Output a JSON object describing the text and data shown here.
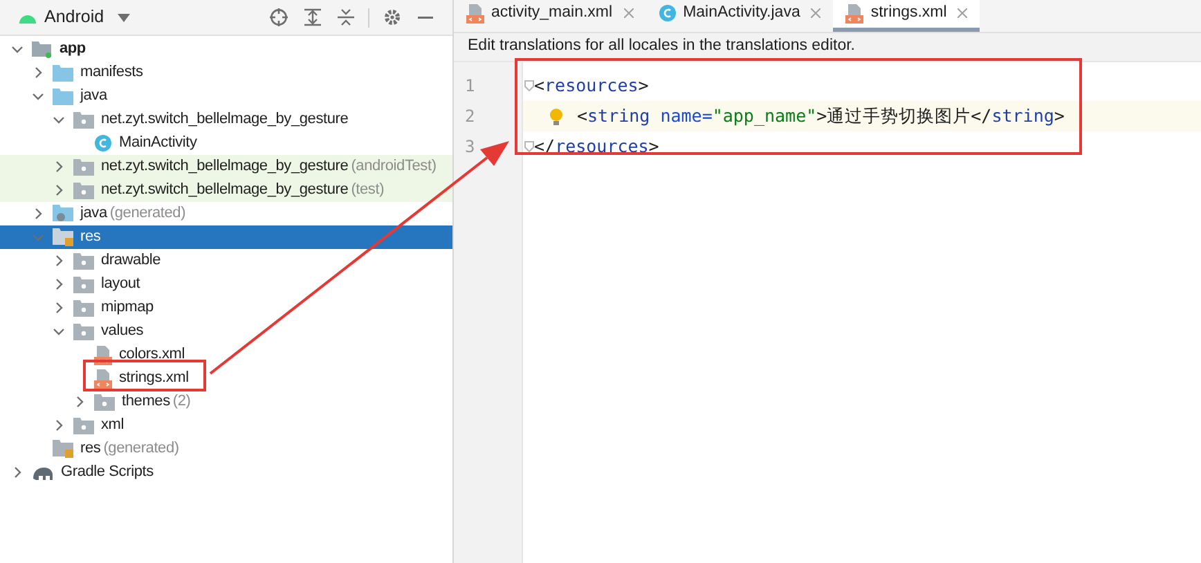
{
  "project_panel": {
    "view_selector": "Android",
    "tree": [
      {
        "label": "app",
        "bold": true,
        "kind": "module",
        "expanded": true,
        "selected": false,
        "highlighted": false,
        "children": [
          {
            "label": "manifests",
            "kind": "folder",
            "expanded": false,
            "selected": false,
            "highlighted": false
          },
          {
            "label": "java",
            "kind": "folder",
            "expanded": true,
            "selected": false,
            "highlighted": false,
            "children": [
              {
                "label": "net.zyt.switch_bellelmage_by_gesture",
                "kind": "package",
                "expanded": true,
                "selected": false,
                "highlighted": false,
                "children": [
                  {
                    "label": "MainActivity",
                    "kind": "class",
                    "selected": false,
                    "highlighted": false
                  }
                ]
              },
              {
                "label": "net.zyt.switch_bellelmage_by_gesture",
                "suffix": "(androidTest)",
                "kind": "package",
                "expanded": false,
                "selected": false,
                "highlighted": true
              },
              {
                "label": "net.zyt.switch_bellelmage_by_gesture",
                "suffix": "(test)",
                "kind": "package",
                "expanded": false,
                "selected": false,
                "highlighted": true
              }
            ]
          },
          {
            "label": "java",
            "suffix": "(generated)",
            "kind": "generated",
            "expanded": false,
            "selected": false,
            "highlighted": false
          },
          {
            "label": "res",
            "kind": "resfolder",
            "expanded": true,
            "selected": true,
            "children": [
              {
                "label": "drawable",
                "kind": "package",
                "expanded": false,
                "selected": false,
                "highlighted": false
              },
              {
                "label": "layout",
                "kind": "package",
                "expanded": false,
                "selected": false,
                "highlighted": false
              },
              {
                "label": "mipmap",
                "kind": "package",
                "expanded": false,
                "selected": false,
                "highlighted": false
              },
              {
                "label": "values",
                "kind": "package",
                "expanded": true,
                "selected": false,
                "highlighted": false,
                "children": [
                  {
                    "label": "colors.xml",
                    "kind": "xml",
                    "selected": false,
                    "highlighted": false
                  },
                  {
                    "label": "strings.xml",
                    "kind": "xml",
                    "selected": false,
                    "highlighted": false
                  },
                  {
                    "label": "themes",
                    "suffix": "(2)",
                    "kind": "package",
                    "expanded": false,
                    "selected": false,
                    "highlighted": false
                  }
                ]
              },
              {
                "label": "xml",
                "kind": "package",
                "expanded": false,
                "selected": false,
                "highlighted": false
              }
            ]
          },
          {
            "label": "res",
            "suffix": "(generated)",
            "kind": "resfolder",
            "selected": false,
            "highlighted": false
          }
        ]
      },
      {
        "label": "Gradle Scripts",
        "kind": "gradle",
        "expanded": false,
        "selected": false,
        "highlighted": false
      }
    ]
  },
  "editor_tabs": [
    {
      "label": "activity_main.xml",
      "kind": "xml",
      "selected": false
    },
    {
      "label": "MainActivity.java",
      "kind": "class",
      "selected": false
    },
    {
      "label": "strings.xml",
      "kind": "xml",
      "selected": true
    }
  ],
  "notification": "Edit translations for all locales in the translations editor.",
  "code_lines": [
    {
      "number": "1",
      "fold": true,
      "bulb": false,
      "current": false,
      "indent": false,
      "tokens": [
        {
          "kind": "punct",
          "text": "<"
        },
        {
          "kind": "tag",
          "text": "resources"
        },
        {
          "kind": "punct",
          "text": ">"
        }
      ]
    },
    {
      "number": "2",
      "fold": false,
      "bulb": true,
      "current": true,
      "indent": true,
      "tokens": [
        {
          "kind": "punct",
          "text": "<"
        },
        {
          "kind": "tag",
          "text": "string "
        },
        {
          "kind": "attr",
          "text": "name="
        },
        {
          "kind": "value",
          "text": "\"app_name\""
        },
        {
          "kind": "punct",
          "text": ">"
        },
        {
          "kind": "text",
          "text": "通过手势切换图片"
        },
        {
          "kind": "punct",
          "text": "</"
        },
        {
          "kind": "tag",
          "text": "string"
        },
        {
          "kind": "punct",
          "text": ">"
        }
      ]
    },
    {
      "number": "3",
      "fold": true,
      "bulb": false,
      "current": false,
      "indent": false,
      "tokens": [
        {
          "kind": "punct",
          "text": "</"
        },
        {
          "kind": "tag",
          "text": "resources"
        },
        {
          "kind": "punct",
          "text": ">"
        }
      ]
    }
  ]
}
